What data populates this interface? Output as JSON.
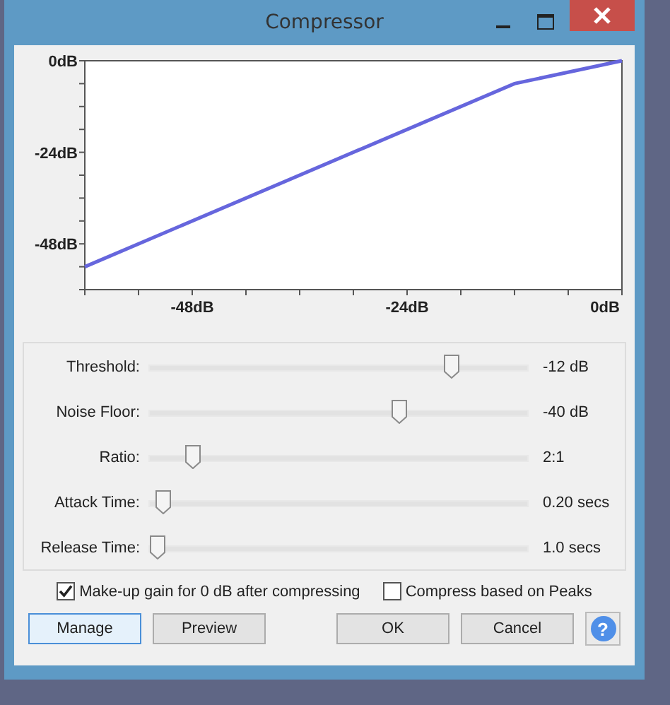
{
  "window": {
    "title": "Compressor"
  },
  "graph": {
    "chart_data": {
      "type": "line",
      "x": [
        -60,
        -12,
        0
      ],
      "series": [
        {
          "color": "#6666dd",
          "values": [
            -54,
            -6,
            0
          ]
        }
      ],
      "xlim": [
        -60,
        0
      ],
      "ylim": [
        -60,
        0
      ],
      "xticks": [
        {
          "value": -48,
          "label": "-48dB"
        },
        {
          "value": -24,
          "label": "-24dB"
        },
        {
          "value": 0,
          "label": "0dB"
        }
      ],
      "yticks": [
        {
          "value": 0,
          "label": "0dB"
        },
        {
          "value": -24,
          "label": "-24dB"
        },
        {
          "value": -48,
          "label": "-48dB"
        }
      ]
    }
  },
  "sliders": [
    {
      "label": "Threshold:",
      "level": 0.8,
      "reading": "-12 dB"
    },
    {
      "label": "Noise Floor:",
      "level": 0.66,
      "reading": "-40 dB"
    },
    {
      "label": "Ratio:",
      "level": 0.115,
      "reading": "2:1"
    },
    {
      "label": "Attack Time:",
      "level": 0.035,
      "reading": "0.20 secs"
    },
    {
      "label": "Release Time:",
      "level": 0.02,
      "reading": "1.0 secs"
    }
  ],
  "options": [
    {
      "label": "Make-up gain for 0 dB after compressing",
      "checked": true
    },
    {
      "label": "Compress based on Peaks",
      "checked": false
    }
  ],
  "buttons": [
    {
      "label": "Manage",
      "kind": "left",
      "selected": true
    },
    {
      "label": "Preview",
      "kind": "left",
      "selected": false
    },
    {
      "label": "OK",
      "kind": "right",
      "selected": false
    },
    {
      "label": "Cancel",
      "kind": "right",
      "selected": false
    },
    {
      "label": "?",
      "kind": "help",
      "selected": false
    }
  ]
}
